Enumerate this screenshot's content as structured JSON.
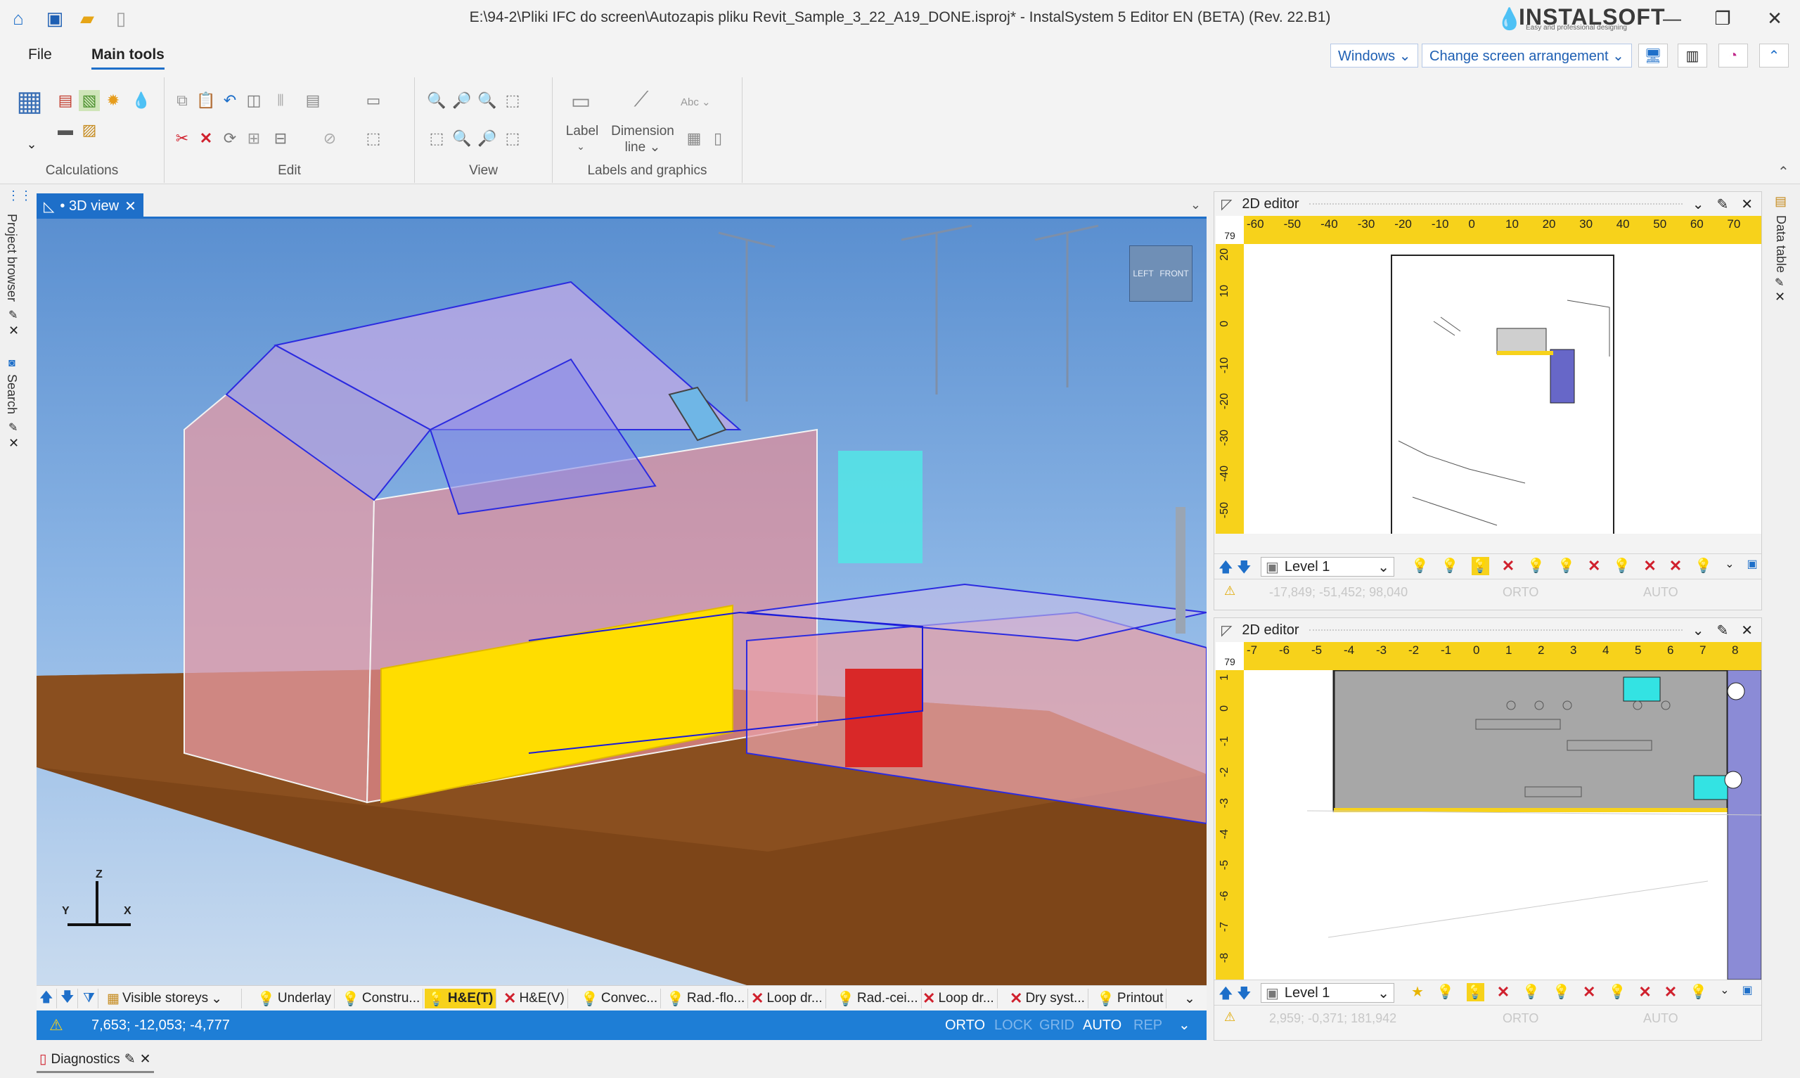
{
  "window": {
    "title": "E:\\94-2\\Pliki IFC do screen\\Autozapis pliku Revit_Sample_3_22_A19_DONE.isproj* - InstalSystem 5 Editor EN (BETA) (Rev. 22.B1)",
    "brand": "INSTALSOFT",
    "brand_tagline": "Easy and professional designing"
  },
  "menu": {
    "file": "File",
    "main_tools": "Main tools",
    "windows": "Windows",
    "change_arrangement": "Change screen arrangement"
  },
  "ribbon": {
    "groups": {
      "calculations": "Calculations",
      "edit": "Edit",
      "view": "View",
      "labels": "Labels and graphics"
    },
    "label_btn": "Label",
    "dimension_btn_1": "Dimension",
    "dimension_btn_2": "line",
    "abc": "Abc"
  },
  "left_dock": {
    "project_browser": "Project browser",
    "search": "Search"
  },
  "right_dock": {
    "data_table": "Data table"
  },
  "view3d": {
    "tab": "• 3D view",
    "cube_left": "LEFT",
    "cube_front": "FRONT",
    "axis_z": "Z",
    "axis_y": "Y",
    "axis_x": "X",
    "toolbar": {
      "visible_storeys": "Visible storeys",
      "underlay": "Underlay",
      "constru": "Constru...",
      "he_t": "H&E(T)",
      "he_v": "H&E(V)",
      "convec": "Convec...",
      "rad_flo": "Rad.-flo...",
      "loop_dr1": "Loop dr...",
      "rad_cei": "Rad.-cei...",
      "loop_dr2": "Loop dr...",
      "dry_syst": "Dry syst...",
      "printout": "Printout"
    },
    "status": {
      "coords": "7,653; -12,053; -4,777",
      "orto": "ORTO",
      "lock": "LOCK",
      "grid": "GRID",
      "auto": "AUTO",
      "rep": "REP"
    }
  },
  "editor_top": {
    "title": "2D editor",
    "ruler_corner": "79",
    "h_ticks": [
      "-60",
      "-50",
      "-40",
      "-30",
      "-20",
      "-10",
      "0",
      "10",
      "20",
      "30",
      "40",
      "50",
      "60",
      "70"
    ],
    "v_ticks": [
      "20",
      "10",
      "0",
      "-10",
      "-20",
      "-30",
      "-40",
      "-50"
    ],
    "level": "Level 1",
    "status": {
      "coords": "-17,849; -51,452; 98,040",
      "orto": "ORTO",
      "auto": "AUTO"
    }
  },
  "editor_bottom": {
    "title": "2D editor",
    "ruler_corner": "79",
    "h_ticks": [
      "-7",
      "-6",
      "-5",
      "-4",
      "-3",
      "-2",
      "-1",
      "0",
      "1",
      "2",
      "3",
      "4",
      "5",
      "6",
      "7",
      "8"
    ],
    "v_ticks": [
      "1",
      "0",
      "-1",
      "-2",
      "-3",
      "-4",
      "-5",
      "-6",
      "-7",
      "-8"
    ],
    "level": "Level 1",
    "status": {
      "coords": "2,959; -0,371; 181,942",
      "orto": "ORTO",
      "auto": "AUTO"
    }
  },
  "diagnostics": {
    "tab": "Diagnostics"
  },
  "colors": {
    "accent": "#1e6fc9",
    "ruler": "#f7d21b",
    "statusbar": "#1e7ed6"
  }
}
